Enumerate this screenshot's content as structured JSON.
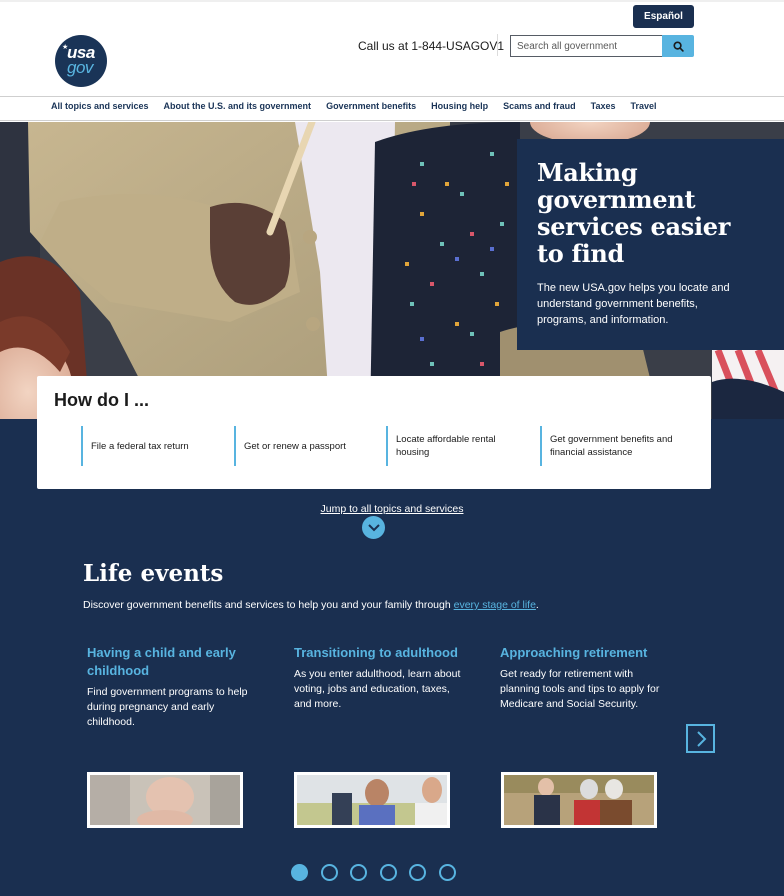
{
  "header": {
    "logo": {
      "top": "usa",
      "bottom": "gov",
      "icon": "usagov-logo"
    },
    "language_button": "Español",
    "phone_text": "Call us at 1-844-USAGOV1",
    "search": {
      "placeholder": "Search all government",
      "value": "",
      "button_icon": "search-icon"
    }
  },
  "nav": {
    "items": [
      {
        "label": "All topics and services"
      },
      {
        "label": "About the U.S. and its government"
      },
      {
        "label": "Government benefits"
      },
      {
        "label": "Housing help"
      },
      {
        "label": "Scams and fraud"
      },
      {
        "label": "Taxes"
      },
      {
        "label": "Travel"
      }
    ]
  },
  "hero": {
    "title": "Making government services easier to find",
    "subtitle": "The new USA.gov helps you locate and understand government benefits, programs, and information."
  },
  "how_do_i": {
    "title": "How do I ...",
    "items": [
      {
        "label": "File a federal tax return"
      },
      {
        "label": "Get or renew a passport"
      },
      {
        "label": "Locate affordable rental housing"
      },
      {
        "label": "Get government benefits and financial assistance"
      }
    ]
  },
  "jump": {
    "label": "Jump to all topics and services",
    "icon": "chevron-down-icon"
  },
  "life_events": {
    "title": "Life events",
    "intro_prefix": "Discover government benefits and services to help you and your family through ",
    "intro_link": "every stage of life",
    "intro_suffix": ".",
    "cards": [
      {
        "title": "Having a child and early childhood",
        "description": "Find government programs to help during pregnancy and early childhood.",
        "image": "newborn-baby-photo"
      },
      {
        "title": "Transitioning to adulthood",
        "description": "As you enter adulthood, learn about voting, jobs and education, taxes, and more.",
        "image": "young-adults-photo"
      },
      {
        "title": "Approaching retirement",
        "description": "Get ready for retirement with planning tools and tips to apply for Medicare and Social Security.",
        "image": "seniors-walking-photo"
      }
    ],
    "next_icon": "chevron-right-icon",
    "carousel": {
      "total_pages": 6,
      "current_page": 1
    }
  },
  "colors": {
    "navy": "#1a2f50",
    "accent": "#58b4e0",
    "nav_text": "#1a3457"
  }
}
